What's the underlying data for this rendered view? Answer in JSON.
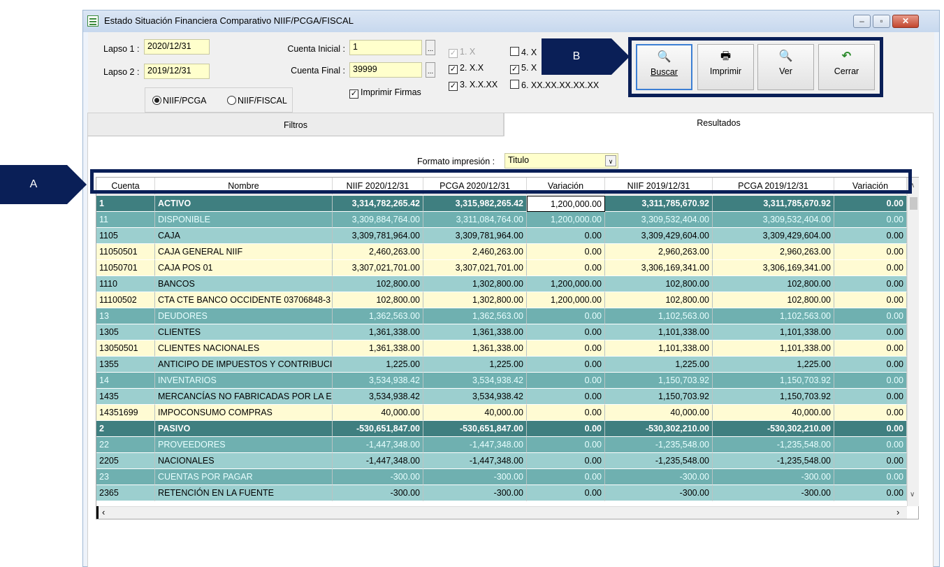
{
  "window": {
    "title": "Estado Situación Financiera Comparativo NIIF/PCGA/FISCAL",
    "controls": {
      "minimize": "–",
      "maximize": "▫",
      "close": "✕"
    }
  },
  "filters": {
    "lapso1_label": "Lapso 1 :",
    "lapso1_value": "2020/12/31",
    "lapso2_label": "Lapso 2 :",
    "lapso2_value": "2019/12/31",
    "cuenta_inicial_label": "Cuenta Inicial :",
    "cuenta_inicial_value": "1",
    "cuenta_final_label": "Cuenta Final :",
    "cuenta_final_value": "39999",
    "dots": "...",
    "imprimir_firmas": "Imprimir Firmas",
    "radio_niif_pcga": "NIIF/PCGA",
    "radio_niif_fiscal": "NIIF/FISCAL",
    "levels": {
      "l1": "1. X",
      "l2": "2. X.X",
      "l3": "3. X.X.XX",
      "l4": "4. X",
      "l5": "5. X",
      "l6": "6. XX.XX.XX.XX.XX"
    }
  },
  "toolbar": {
    "buscar": "Buscar",
    "imprimir": "Imprimir",
    "ver": "Ver",
    "cerrar": "Cerrar"
  },
  "tabs": {
    "filtros": "Filtros",
    "resultados": "Resultados"
  },
  "formato": {
    "label": "Formato impresión :",
    "value": "Titulo"
  },
  "grid": {
    "headers": [
      "Cuenta",
      "Nombre",
      "NIIF 2020/12/31",
      "PCGA 2020/12/31",
      "Variación",
      "NIIF 2019/12/31",
      "PCGA 2019/12/31",
      "Variación"
    ],
    "rows": [
      {
        "level": 1,
        "cells": [
          "1",
          "ACTIVO",
          "3,314,782,265.42",
          "3,315,982,265.42",
          "1,200,000.00",
          "3,311,785,670.92",
          "3,311,785,670.92",
          "0.00"
        ]
      },
      {
        "level": 2,
        "cells": [
          "11",
          "DISPONIBLE",
          "3,309,884,764.00",
          "3,311,084,764.00",
          "1,200,000.00",
          "3,309,532,404.00",
          "3,309,532,404.00",
          "0.00"
        ]
      },
      {
        "level": 3,
        "cells": [
          "1105",
          "CAJA",
          "3,309,781,964.00",
          "3,309,781,964.00",
          "0.00",
          "3,309,429,604.00",
          "3,309,429,604.00",
          "0.00"
        ]
      },
      {
        "level": 4,
        "cells": [
          "11050501",
          "CAJA GENERAL NIIF",
          "2,460,263.00",
          "2,460,263.00",
          "0.00",
          "2,960,263.00",
          "2,960,263.00",
          "0.00"
        ]
      },
      {
        "level": 4,
        "cells": [
          "11050701",
          "CAJA POS 01",
          "3,307,021,701.00",
          "3,307,021,701.00",
          "0.00",
          "3,306,169,341.00",
          "3,306,169,341.00",
          "0.00"
        ]
      },
      {
        "level": 3,
        "cells": [
          "1110",
          "BANCOS",
          "102,800.00",
          "1,302,800.00",
          "1,200,000.00",
          "102,800.00",
          "102,800.00",
          "0.00"
        ]
      },
      {
        "level": 4,
        "cells": [
          "11100502",
          "CTA CTE BANCO OCCIDENTE 03706848-3",
          "102,800.00",
          "1,302,800.00",
          "1,200,000.00",
          "102,800.00",
          "102,800.00",
          "0.00"
        ]
      },
      {
        "level": 2,
        "cells": [
          "13",
          "DEUDORES",
          "1,362,563.00",
          "1,362,563.00",
          "0.00",
          "1,102,563.00",
          "1,102,563.00",
          "0.00"
        ]
      },
      {
        "level": 3,
        "cells": [
          "1305",
          "CLIENTES",
          "1,361,338.00",
          "1,361,338.00",
          "0.00",
          "1,101,338.00",
          "1,101,338.00",
          "0.00"
        ]
      },
      {
        "level": 4,
        "cells": [
          "13050501",
          "CLIENTES NACIONALES",
          "1,361,338.00",
          "1,361,338.00",
          "0.00",
          "1,101,338.00",
          "1,101,338.00",
          "0.00"
        ]
      },
      {
        "level": 3,
        "cells": [
          "1355",
          "ANTICIPO DE IMPUESTOS Y CONTRIBUCIO",
          "1,225.00",
          "1,225.00",
          "0.00",
          "1,225.00",
          "1,225.00",
          "0.00"
        ]
      },
      {
        "level": 2,
        "cells": [
          "14",
          "INVENTARIOS",
          "3,534,938.42",
          "3,534,938.42",
          "0.00",
          "1,150,703.92",
          "1,150,703.92",
          "0.00"
        ]
      },
      {
        "level": 3,
        "cells": [
          "1435",
          "MERCANCÍAS NO FABRICADAS POR LA EMF",
          "3,534,938.42",
          "3,534,938.42",
          "0.00",
          "1,150,703.92",
          "1,150,703.92",
          "0.00"
        ]
      },
      {
        "level": 4,
        "cells": [
          "14351699",
          "IMPOCONSUMO COMPRAS",
          "40,000.00",
          "40,000.00",
          "0.00",
          "40,000.00",
          "40,000.00",
          "0.00"
        ]
      },
      {
        "level": 1,
        "cells": [
          "2",
          "PASIVO",
          "-530,651,847.00",
          "-530,651,847.00",
          "0.00",
          "-530,302,210.00",
          "-530,302,210.00",
          "0.00"
        ]
      },
      {
        "level": 2,
        "cells": [
          "22",
          "PROVEEDORES",
          "-1,447,348.00",
          "-1,447,348.00",
          "0.00",
          "-1,235,548.00",
          "-1,235,548.00",
          "0.00"
        ]
      },
      {
        "level": 3,
        "cells": [
          "2205",
          "NACIONALES",
          "-1,447,348.00",
          "-1,447,348.00",
          "0.00",
          "-1,235,548.00",
          "-1,235,548.00",
          "0.00"
        ]
      },
      {
        "level": 2,
        "cells": [
          "23",
          "CUENTAS POR PAGAR",
          "-300.00",
          "-300.00",
          "0.00",
          "-300.00",
          "-300.00",
          "0.00"
        ]
      },
      {
        "level": 3,
        "cells": [
          "2365",
          "RETENCIÓN EN LA FUENTE",
          "-300.00",
          "-300.00",
          "0.00",
          "-300.00",
          "-300.00",
          "0.00"
        ]
      }
    ]
  },
  "annotations": {
    "a": "A",
    "b": "B"
  },
  "colors": {
    "level1": "#3f7f80",
    "level2": "#6fb0b0",
    "level3": "#9ccfcf",
    "level4": "#fffbd3",
    "callout": "#0a1f57"
  }
}
